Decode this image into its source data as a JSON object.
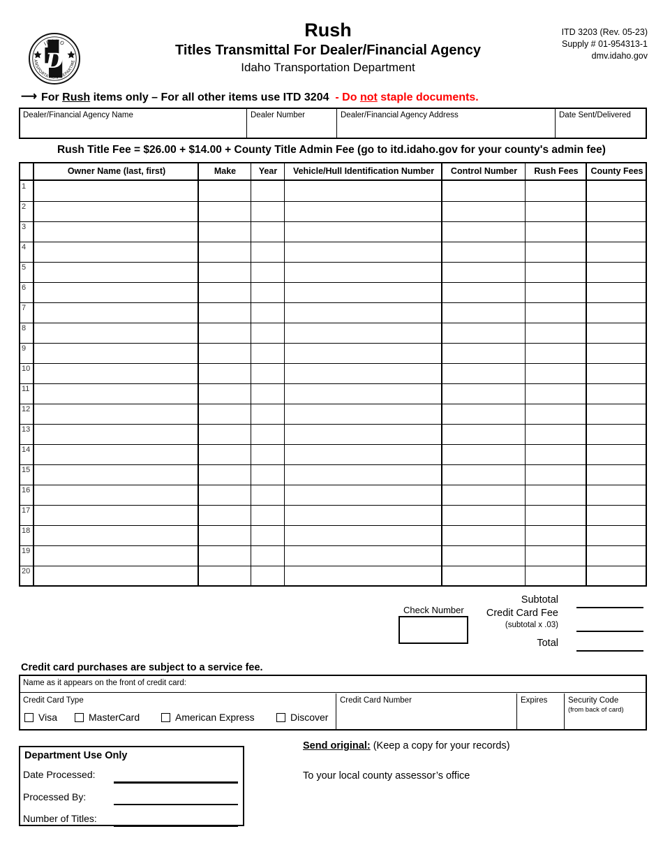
{
  "document": {
    "form_number": "ITD 3203   (Rev. 05-23)",
    "supply_number": "Supply # 01-954313-1",
    "website": "dmv.idaho.gov",
    "title_rush": "Rush",
    "title_main": "Titles Transmittal For Dealer/Financial Agency",
    "title_sub": "Idaho Transportation Department",
    "logo_top_text": "IDAHO",
    "logo_ring_text": "TRANSPORTATION DEPARTMENT"
  },
  "notice": {
    "arrow": "⟶",
    "part1": "For ",
    "rush_word": "Rush",
    "part2": " items only – For all other items use ITD 3204",
    "red_pre": "- Do ",
    "red_not": "not",
    "red_post": " staple documents."
  },
  "dealer_info": {
    "fields": [
      {
        "label": "Dealer/Financial Agency Name",
        "value": ""
      },
      {
        "label": "Dealer Number",
        "value": ""
      },
      {
        "label": "Dealer/Financial Agency Address",
        "value": ""
      },
      {
        "label": "Date Sent/Delivered",
        "value": ""
      }
    ]
  },
  "fee_line": "Rush Title Fee = $26.00 + $14.00 + County Title Admin Fee (go to itd.idaho.gov for your county's admin fee)",
  "table": {
    "columns": [
      {
        "key": "num",
        "label": ""
      },
      {
        "key": "owner",
        "label": "Owner Name (last, first)"
      },
      {
        "key": "make",
        "label": "Make"
      },
      {
        "key": "year",
        "label": "Year"
      },
      {
        "key": "vin",
        "label": "Vehicle/Hull Identification Number"
      },
      {
        "key": "control",
        "label": "Control Number"
      },
      {
        "key": "rush_fees",
        "label": "Rush Fees"
      },
      {
        "key": "county_fees",
        "label": "County Fees"
      }
    ],
    "row_numbers": [
      "1",
      "2",
      "3",
      "4",
      "5",
      "6",
      "7",
      "8",
      "9",
      "10",
      "11",
      "12",
      "13",
      "14",
      "15",
      "16",
      "17",
      "18",
      "19",
      "20"
    ],
    "rows": [
      {
        "num": "1",
        "owner": "",
        "make": "",
        "year": "",
        "vin": "",
        "control": "",
        "rush_fees": "",
        "county_fees": ""
      },
      {
        "num": "2",
        "owner": "",
        "make": "",
        "year": "",
        "vin": "",
        "control": "",
        "rush_fees": "",
        "county_fees": ""
      },
      {
        "num": "3",
        "owner": "",
        "make": "",
        "year": "",
        "vin": "",
        "control": "",
        "rush_fees": "",
        "county_fees": ""
      },
      {
        "num": "4",
        "owner": "",
        "make": "",
        "year": "",
        "vin": "",
        "control": "",
        "rush_fees": "",
        "county_fees": ""
      },
      {
        "num": "5",
        "owner": "",
        "make": "",
        "year": "",
        "vin": "",
        "control": "",
        "rush_fees": "",
        "county_fees": ""
      },
      {
        "num": "6",
        "owner": "",
        "make": "",
        "year": "",
        "vin": "",
        "control": "",
        "rush_fees": "",
        "county_fees": ""
      },
      {
        "num": "7",
        "owner": "",
        "make": "",
        "year": "",
        "vin": "",
        "control": "",
        "rush_fees": "",
        "county_fees": ""
      },
      {
        "num": "8",
        "owner": "",
        "make": "",
        "year": "",
        "vin": "",
        "control": "",
        "rush_fees": "",
        "county_fees": ""
      },
      {
        "num": "9",
        "owner": "",
        "make": "",
        "year": "",
        "vin": "",
        "control": "",
        "rush_fees": "",
        "county_fees": ""
      },
      {
        "num": "10",
        "owner": "",
        "make": "",
        "year": "",
        "vin": "",
        "control": "",
        "rush_fees": "",
        "county_fees": ""
      },
      {
        "num": "11",
        "owner": "",
        "make": "",
        "year": "",
        "vin": "",
        "control": "",
        "rush_fees": "",
        "county_fees": ""
      },
      {
        "num": "12",
        "owner": "",
        "make": "",
        "year": "",
        "vin": "",
        "control": "",
        "rush_fees": "",
        "county_fees": ""
      },
      {
        "num": "13",
        "owner": "",
        "make": "",
        "year": "",
        "vin": "",
        "control": "",
        "rush_fees": "",
        "county_fees": ""
      },
      {
        "num": "14",
        "owner": "",
        "make": "",
        "year": "",
        "vin": "",
        "control": "",
        "rush_fees": "",
        "county_fees": ""
      },
      {
        "num": "15",
        "owner": "",
        "make": "",
        "year": "",
        "vin": "",
        "control": "",
        "rush_fees": "",
        "county_fees": ""
      },
      {
        "num": "16",
        "owner": "",
        "make": "",
        "year": "",
        "vin": "",
        "control": "",
        "rush_fees": "",
        "county_fees": ""
      },
      {
        "num": "17",
        "owner": "",
        "make": "",
        "year": "",
        "vin": "",
        "control": "",
        "rush_fees": "",
        "county_fees": ""
      },
      {
        "num": "18",
        "owner": "",
        "make": "",
        "year": "",
        "vin": "",
        "control": "",
        "rush_fees": "",
        "county_fees": ""
      },
      {
        "num": "19",
        "owner": "",
        "make": "",
        "year": "",
        "vin": "",
        "control": "",
        "rush_fees": "",
        "county_fees": ""
      },
      {
        "num": "20",
        "owner": "",
        "make": "",
        "year": "",
        "vin": "",
        "control": "",
        "rush_fees": "",
        "county_fees": ""
      }
    ]
  },
  "check": {
    "label": "Check Number",
    "value": ""
  },
  "totals": {
    "subtotal_label": "Subtotal",
    "subtotal_value": "",
    "cc_fee_label": "Credit Card Fee",
    "cc_fee_note": "(subtotal x .03)",
    "cc_fee_value": "",
    "total_label": "Total",
    "total_value": ""
  },
  "credit_card": {
    "notice": "Credit card purchases are subject to a service fee.",
    "name_label": "Name as it appears on the front of credit card:",
    "name_value": "",
    "type_label": "Credit Card Type",
    "types": [
      {
        "label": "Visa",
        "checked": false
      },
      {
        "label": "MasterCard",
        "checked": false
      },
      {
        "label": "American Express",
        "checked": false
      },
      {
        "label": "Discover",
        "checked": false
      }
    ],
    "number_label": "Credit Card Number",
    "number_value": "",
    "expires_label": "Expires",
    "expires_value": "",
    "security_label": "Security Code",
    "security_note": "(from back of card)",
    "security_value": ""
  },
  "department_use": {
    "title": "Department Use Only",
    "fields": [
      {
        "label": "Date Processed:",
        "value": ""
      },
      {
        "label": "Processed By:",
        "value": ""
      },
      {
        "label": "Number of Titles:",
        "value": ""
      }
    ]
  },
  "send_original": {
    "heading": "Send original:",
    "note": "(Keep a copy for your records)",
    "destination": "To your local county assessor’s office"
  },
  "colors": {
    "accent_red": "#ff0000",
    "ink": "#000000",
    "paper": "#ffffff"
  }
}
